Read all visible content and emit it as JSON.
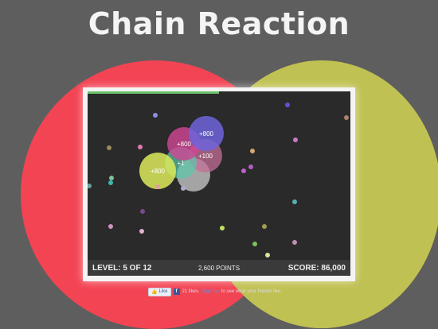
{
  "title": "Chain Reaction",
  "status": {
    "level_text": "LEVEL: 5 OF 12",
    "points_text": "2,600 POINTS",
    "score_text": "SCORE: 86,000",
    "level_progress": 0.5
  },
  "social": {
    "like_label": "Like",
    "likes_text": "21 likes.",
    "signup_label": "Sign Up",
    "suffix_text": "to see what your friends like."
  },
  "explosions": [
    {
      "label": "",
      "color": "rgba(205,205,205,0.75)"
    },
    {
      "label": "+100",
      "color": "rgba(196,110,150,0.75)"
    },
    {
      "label": "+1",
      "color": "rgba(90,200,170,0.7)"
    },
    {
      "label": "+800",
      "color": "rgba(210,70,150,0.8)"
    },
    {
      "label": "+800",
      "color": "rgba(110,100,220,0.85)"
    },
    {
      "label": "+800",
      "color": "rgba(220,235,90,0.85)"
    }
  ],
  "balls": [
    {
      "color": "#8a8fe0"
    },
    {
      "color": "#5a55d8"
    },
    {
      "color": "#b08070"
    },
    {
      "color": "#c97ac0"
    },
    {
      "color": "#e07ab0"
    },
    {
      "color": "#9a8a5a"
    },
    {
      "color": "#e0a0a0"
    },
    {
      "color": "#d8a870"
    },
    {
      "color": "#b060c0"
    },
    {
      "color": "#c060d0"
    },
    {
      "color": "#80c0a0"
    },
    {
      "color": "#3ab8b0"
    },
    {
      "color": "#6aa0a0"
    },
    {
      "color": "#5ab0b0"
    },
    {
      "color": "#b0a8d0"
    },
    {
      "color": "#7a4a8a"
    },
    {
      "color": "#d090c0"
    },
    {
      "color": "#e0b0d0"
    },
    {
      "color": "#c0e060"
    },
    {
      "color": "#a0a050"
    },
    {
      "color": "#80c060"
    },
    {
      "color": "#e0e0a0"
    },
    {
      "color": "#c090b0"
    }
  ]
}
